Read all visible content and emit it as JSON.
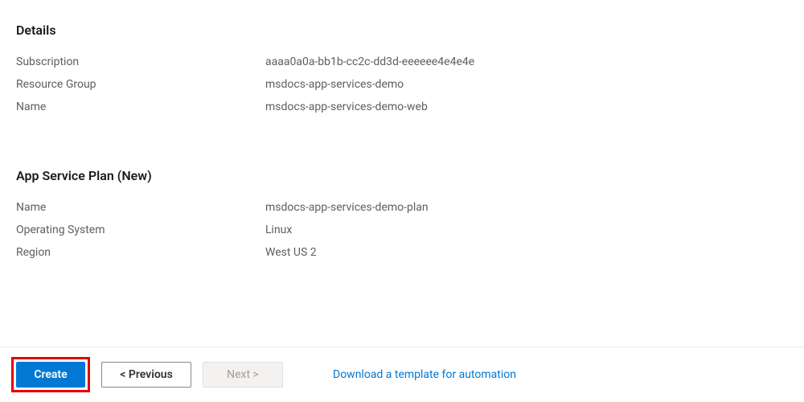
{
  "details": {
    "heading": "Details",
    "rows": {
      "subscription": {
        "label": "Subscription",
        "value": "aaaa0a0a-bb1b-cc2c-dd3d-eeeeee4e4e4e"
      },
      "resourceGroup": {
        "label": "Resource Group",
        "value": "msdocs-app-services-demo"
      },
      "name": {
        "label": "Name",
        "value": "msdocs-app-services-demo-web"
      }
    }
  },
  "appServicePlan": {
    "heading": "App Service Plan (New)",
    "rows": {
      "name": {
        "label": "Name",
        "value": "msdocs-app-services-demo-plan"
      },
      "os": {
        "label": "Operating System",
        "value": "Linux"
      },
      "region": {
        "label": "Region",
        "value": "West US 2"
      }
    }
  },
  "footer": {
    "create": "Create",
    "previous": "< Previous",
    "next": "Next >",
    "downloadTemplate": "Download a template for automation"
  }
}
